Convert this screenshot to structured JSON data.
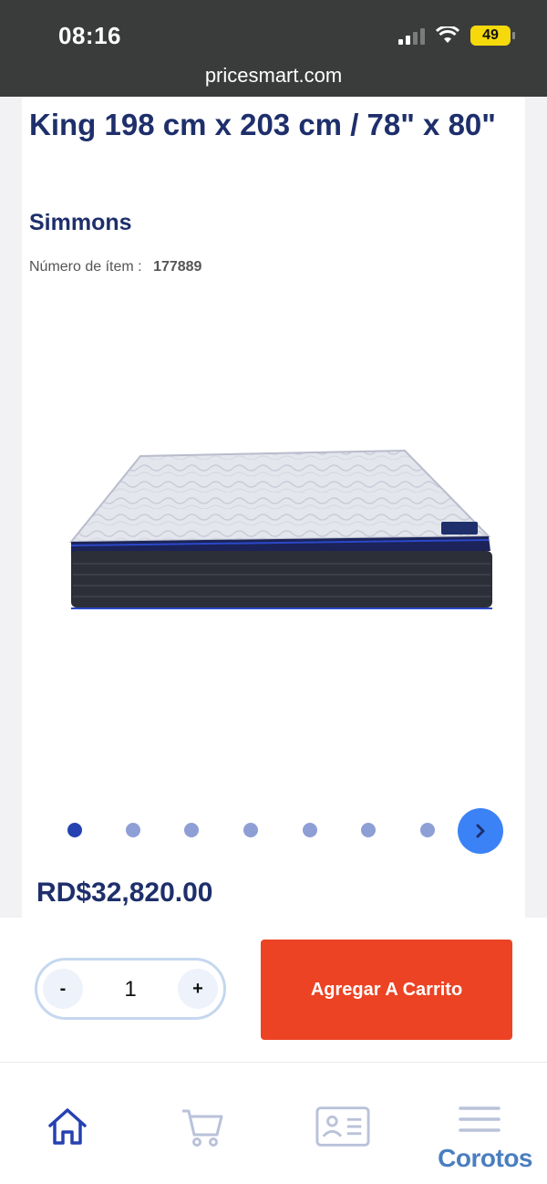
{
  "status": {
    "time": "08:16",
    "battery": "49"
  },
  "browser": {
    "url": "pricesmart.com"
  },
  "product": {
    "title": "King 198 cm x 203 cm / 78\" x 80\"",
    "brand": "Simmons",
    "item_number_label": "Número de ítem :",
    "item_number": "177889",
    "image_icon": "mattress-image",
    "carousel": {
      "total_dots": 7,
      "active_index": 0
    },
    "price": "RD$32,820.00"
  },
  "cart": {
    "minus_label": "-",
    "quantity": "1",
    "plus_label": "+",
    "add_button_label": "Agregar A Carrito"
  },
  "tabs": [
    {
      "name": "home",
      "icon": "home-icon"
    },
    {
      "name": "cart",
      "icon": "cart-icon"
    },
    {
      "name": "membership",
      "icon": "id-card-icon"
    },
    {
      "name": "menu",
      "icon": "menu-icon"
    }
  ],
  "watermark": "Corotos",
  "colors": {
    "brand_navy": "#1e2f6b",
    "cta": "#ec4324",
    "accent_blue": "#3b82f6"
  }
}
